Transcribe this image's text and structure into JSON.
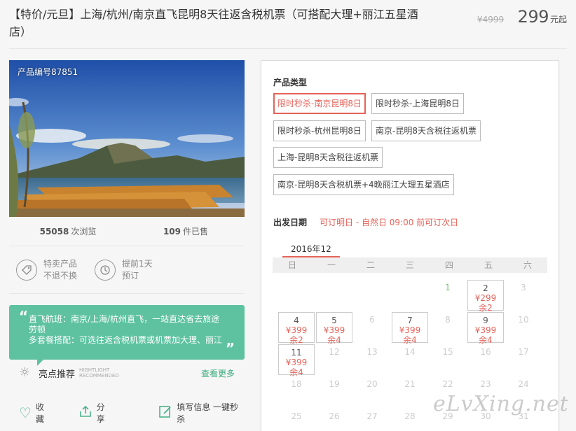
{
  "header": {
    "title": "【特价/元旦】上海/杭州/南京直飞昆明8天往返含税机票（可搭配大理+丽江五星酒店）",
    "orig_price": "¥4999",
    "price": "299",
    "price_unit": "元起"
  },
  "photo": {
    "product_no": "产品编号87851"
  },
  "stats": {
    "views": "55058",
    "views_label": "次浏览",
    "sold": "109",
    "sold_label": "件已售"
  },
  "features": [
    {
      "icon": "tag-icon",
      "line1": "特卖产品",
      "line2": "不退不换"
    },
    {
      "icon": "clock-icon",
      "line1": "提前1天",
      "line2": "预订"
    }
  ],
  "highlight": {
    "line1": "直飞航班：南京/上海/杭州直飞，一站直达省去旅途劳顿",
    "line2": "多套餐搭配：可选往返含税机票或机票加大理、丽江"
  },
  "highlight_title": {
    "label": "亮点推荐",
    "en1": "HIGHTLIGHT",
    "en2": "RECOMMENDED",
    "more": "查看更多"
  },
  "actions": {
    "fav": "收藏",
    "share": "分享",
    "sign": "填写信息 一键秒杀"
  },
  "product_type": {
    "title": "产品类型",
    "options": [
      "限时秒杀-南京昆明8日",
      "限时秒杀-上海昆明8日",
      "限时秒杀-杭州昆明8日",
      "南京-昆明8天含税往返机票",
      "上海-昆明8天含税往返机票",
      "南京-昆明8天含税机票+4晚丽江大理五星酒店"
    ],
    "selected": 0
  },
  "departure": {
    "title": "出发日期",
    "note": "可订明日 - 自然日 09:00 前可订次日",
    "month": "2016年12",
    "weekdays": [
      "日",
      "一",
      "二",
      "三",
      "四",
      "五",
      "六"
    ],
    "days": {
      "d1": "1",
      "d2": "2",
      "d3": "3",
      "d4": "4",
      "d5": "5",
      "d6": "6",
      "d7": "7",
      "d8": "8",
      "d9": "9",
      "d10": "10",
      "d11": "11",
      "d12": "12",
      "d13": "13",
      "d14": "14",
      "d15": "15",
      "d16": "16",
      "d17": "17",
      "d18": "18",
      "d19": "19",
      "d20": "20",
      "d21": "21",
      "d22": "22",
      "d23": "23",
      "d24": "24",
      "d25": "25",
      "d26": "26",
      "d27": "27",
      "d28": "28",
      "d29": "29",
      "d30": "30",
      "d31": "31"
    },
    "prices": {
      "p2": "¥299",
      "r2": "余2",
      "p4": "¥399",
      "r4": "余2",
      "p5": "¥399",
      "r5": "余4",
      "p7": "¥399",
      "r7": "余4",
      "p9": "¥399",
      "r9": "余4",
      "p11": "¥399",
      "r11": "余4"
    }
  },
  "watermark": "eLvXing.net",
  "colors": {
    "accent": "#e6635a",
    "green": "#5ec2a0",
    "link": "#3aab7c"
  }
}
